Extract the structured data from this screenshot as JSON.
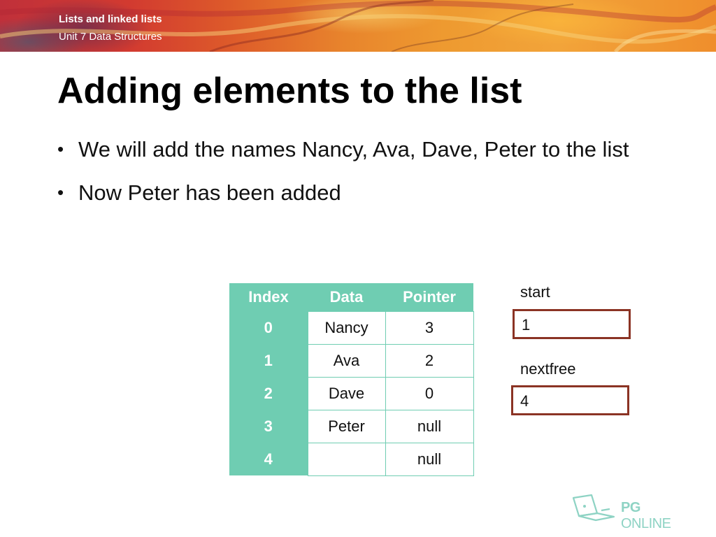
{
  "header": {
    "title": "Lists and linked lists",
    "subtitle": "Unit 7 Data Structures"
  },
  "slide": {
    "title": "Adding elements to the list",
    "bullets": [
      "We will add the names Nancy, Ava, Dave, Peter to the list",
      "Now Peter has been added"
    ],
    "bullet_glyph": "•"
  },
  "table": {
    "headers": [
      "Index",
      "Data",
      "Pointer"
    ],
    "rows": [
      {
        "index": "0",
        "data": "Nancy",
        "pointer": "3"
      },
      {
        "index": "1",
        "data": "Ava",
        "pointer": "2"
      },
      {
        "index": "2",
        "data": "Dave",
        "pointer": "0"
      },
      {
        "index": "3",
        "data": "Peter",
        "pointer": "null"
      },
      {
        "index": "4",
        "data": "",
        "pointer": "null"
      }
    ]
  },
  "start": {
    "label": "start",
    "value": "1"
  },
  "nextfree": {
    "label": "nextfree",
    "value": "4"
  },
  "logo": {
    "bold": "PG",
    "rest": " ONLINE",
    "icon": "laptop-icon"
  },
  "colors": {
    "table_accent": "#6fcdb2",
    "box_border": "#8b3324",
    "banner_red": "#c0303a",
    "banner_orange": "#ee9a30"
  }
}
